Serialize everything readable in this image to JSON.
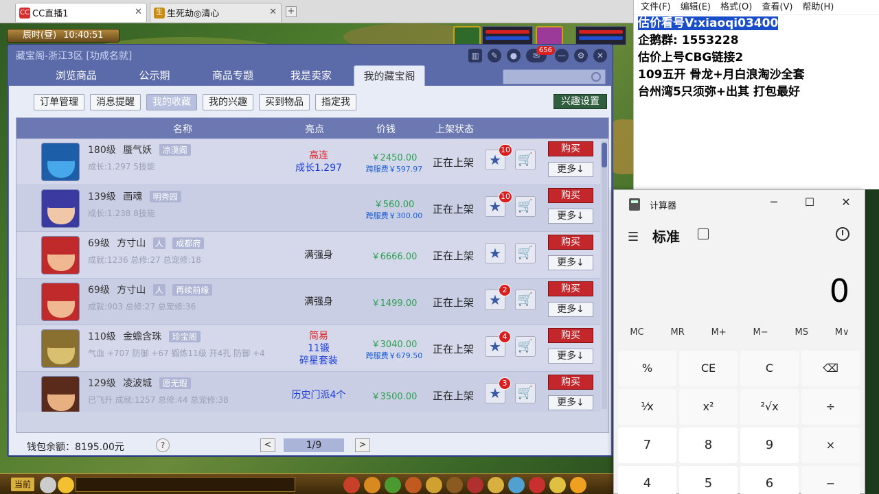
{
  "browser": {
    "tabs": [
      {
        "label": "CC直播1",
        "active": true
      },
      {
        "label": "生死劫◎清心",
        "active": false
      }
    ],
    "new_tab": "+"
  },
  "game": {
    "time_label": "辰时(昼)",
    "clock": "10:40:51",
    "current_button": "当前"
  },
  "cbg": {
    "title": "藏宝阁-浙江3区 [功成名就]",
    "message_count": "656",
    "nav_tabs": [
      "浏览商品",
      "公示期",
      "商品专题",
      "我是卖家",
      "我的藏宝阁"
    ],
    "active_nav": 4,
    "sub_tabs": [
      "订单管理",
      "消息提醒",
      "我的收藏",
      "我的兴趣",
      "买到物品",
      "指定我"
    ],
    "active_sub": 2,
    "interest_settings": "兴趣设置",
    "columns": {
      "name": "名称",
      "highlight": "亮点",
      "price": "价钱",
      "status": "上架状态"
    },
    "rows": [
      {
        "name": "180级",
        "char": "蜃气妖",
        "tag": "凉漠阁",
        "stats": "成长:1.297 5技能",
        "highlight": [
          "高连",
          "成长1.297"
        ],
        "highlight_colors": [
          "#e02020",
          "#1b3cd8"
        ],
        "price": "￥2450.00",
        "cross": "跨服费￥597.97",
        "status": "正在上架",
        "fav_count": "10",
        "buy": "购买",
        "more": "更多↓",
        "avatar": "blue"
      },
      {
        "name": "139级",
        "char": "画魂",
        "tag": "明秀园",
        "stats": "成长:1.238 8技能",
        "highlight": [],
        "highlight_colors": [],
        "price": "￥560.00",
        "cross": "跨服费￥300.00",
        "status": "正在上架",
        "fav_count": "10",
        "buy": "购买",
        "more": "更多↓",
        "avatar": "purple"
      },
      {
        "name": "69级",
        "char": "方寸山",
        "tag": "成都府",
        "tag2": "人",
        "stats": "成就:1236 总修:27 总宠修:18",
        "highlight": [
          "满强身"
        ],
        "highlight_colors": [
          "#222222"
        ],
        "price": "￥6666.00",
        "cross": "",
        "status": "正在上架",
        "fav_count": "",
        "buy": "购买",
        "more": "更多↓",
        "avatar": "red"
      },
      {
        "name": "69级",
        "char": "方寸山",
        "tag": "再续前缘",
        "tag2": "人",
        "stats": "成就:903 总修:27 总宠修:36",
        "highlight": [
          "满强身"
        ],
        "highlight_colors": [
          "#222222"
        ],
        "price": "￥1499.00",
        "cross": "",
        "status": "正在上架",
        "fav_count": "2",
        "buy": "购买",
        "more": "更多↓",
        "avatar": "red"
      },
      {
        "name": "110级",
        "char": "金蟾含珠",
        "tag": "珍宝阁",
        "stats": "气血 +707 防御 +67 锻炼11级 开4孔 防御 +4",
        "highlight": [
          "简易",
          "11锻",
          "碎星套装"
        ],
        "highlight_colors": [
          "#e02020",
          "#1b3cd8",
          "#1b3cd8"
        ],
        "price": "￥3040.00",
        "cross": "跨服费￥679.50",
        "status": "正在上架",
        "fav_count": "4",
        "buy": "购买",
        "more": "更多↓",
        "avatar": "gold"
      },
      {
        "name": "129级",
        "char": "凌波城",
        "tag": "愿无瑕",
        "stats": "已飞升 成就:1257 总修:44 总宠修:38",
        "highlight": [
          "历史门派4个"
        ],
        "highlight_colors": [
          "#1b3cd8"
        ],
        "price": "￥3500.00",
        "cross": "",
        "status": "正在上架",
        "fav_count": "3",
        "buy": "购买",
        "more": "更多↓",
        "avatar": "brown"
      }
    ],
    "wallet": "钱包余额：8195.00元",
    "help": "?",
    "page": "1/9",
    "prev": "<",
    "next": ">"
  },
  "notepad": {
    "menu": [
      "文件(F)",
      "编辑(E)",
      "格式(O)",
      "查看(V)",
      "帮助(H)"
    ],
    "lines": [
      {
        "text": "估价看号V:xiaoqi03400",
        "selected": true
      },
      {
        "text": "企鹅群:  1553228",
        "selected": false
      },
      {
        "text": "估价上号CBG链接2",
        "selected": false
      },
      {
        "text": "109五开 骨龙+月白浪淘沙全套",
        "selected": false
      },
      {
        "text": "台州湾5只须弥+出其 打包最好",
        "selected": false
      }
    ]
  },
  "calculator": {
    "title": "计算器",
    "mode": "标准",
    "display": "0",
    "memory": [
      "MC",
      "MR",
      "M+",
      "M−",
      "MS",
      "M∨"
    ],
    "keys": [
      "%",
      "CE",
      "C",
      "⌫",
      "¹⁄x",
      "x²",
      "²√x",
      "÷",
      "7",
      "8",
      "9",
      "×",
      "4",
      "5",
      "6",
      "−"
    ]
  }
}
